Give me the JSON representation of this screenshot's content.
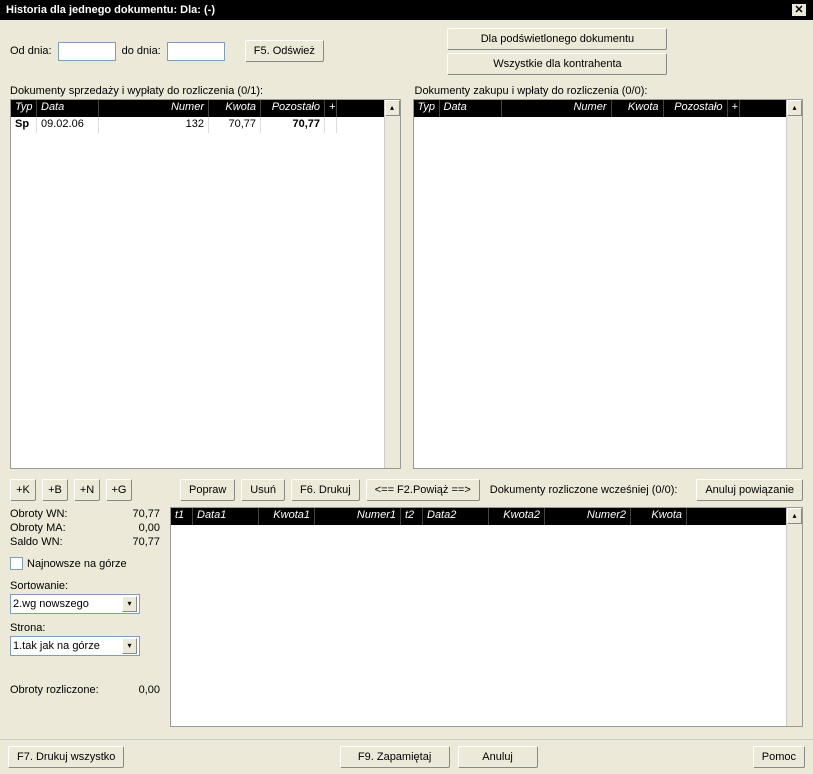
{
  "title": "Historia dla jednego dokumentu: Dla: (-)",
  "filters": {
    "od_label": "Od dnia:",
    "do_label": "do dnia:",
    "od_value": "",
    "do_value": "",
    "refresh": "F5. Odśwież"
  },
  "scope_buttons": {
    "doc": "Dla podświetlonego dokumentu",
    "all": "Wszystkie dla kontrahenta"
  },
  "left_section": {
    "label": "Dokumenty sprzedaży i wypłaty do rozliczenia (0/1):",
    "headers": {
      "typ": "Typ",
      "data": "Data",
      "numer": "Numer",
      "kwota": "Kwota",
      "pozostalo": "Pozostało",
      "plus": "+"
    },
    "row": {
      "typ": "Sp",
      "data": "09.02.06",
      "numer": "132",
      "kwota": "70,77",
      "pozostalo": "70,77"
    }
  },
  "right_section": {
    "label": "Dokumenty zakupu i wpłaty do rozliczenia (0/0):",
    "headers": {
      "typ": "Typ",
      "data": "Data",
      "numer": "Numer",
      "kwota": "Kwota",
      "pozostalo": "Pozostało",
      "plus": "+"
    }
  },
  "mid": {
    "plus_k": "+K",
    "plus_b": "+B",
    "plus_n": "+N",
    "plus_g": "+G",
    "popraw": "Popraw",
    "usun": "Usuń",
    "drukuj": "F6. Drukuj",
    "powiaz": "<== F2.Powiąż ==>",
    "rozliczone_label": "Dokumenty rozliczone wcześniej (0/0):",
    "anuluj_pow": "Anuluj powiązanie"
  },
  "sidebar": {
    "obroty_wn_label": "Obroty WN:",
    "obroty_wn": "70,77",
    "obroty_ma_label": "Obroty MA:",
    "obroty_ma": "0,00",
    "saldo_label": "Saldo WN:",
    "saldo": "70,77",
    "najnowsze": "Najnowsze na górze",
    "sortowanie_label": "Sortowanie:",
    "sortowanie_value": "2.wg nowszego",
    "strona_label": "Strona:",
    "strona_value": "1.tak jak na górze",
    "obroty_rozl_label": "Obroty rozliczone:",
    "obroty_rozl": "0,00"
  },
  "bottom_headers": {
    "t1": "t1",
    "data1": "Data1",
    "kwota1": "Kwota1",
    "numer1": "Numer1",
    "t2": "t2",
    "data2": "Data2",
    "kwota2": "Kwota2",
    "numer2": "Numer2",
    "kwota": "Kwota"
  },
  "footer": {
    "drukuj_all": "F7. Drukuj wszystko",
    "zapamietaj": "F9. Zapamiętaj",
    "anuluj": "Anuluj",
    "pomoc": "Pomoc"
  }
}
